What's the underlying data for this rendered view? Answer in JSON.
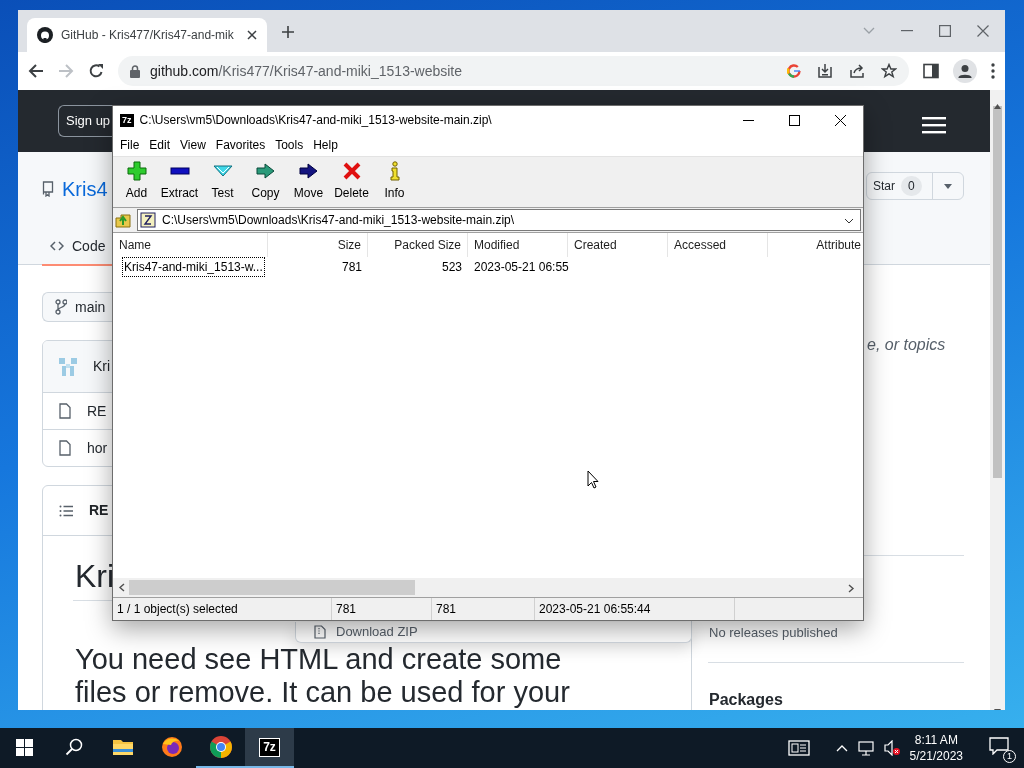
{
  "browser": {
    "tabs": [
      {
        "title": "GitHub - Kris477/Kris47-and-mik",
        "selected": true
      }
    ],
    "url_host": "github.com",
    "url_path": "/Kris477/Kris47-and-miki_1513-website"
  },
  "github": {
    "signup": "Sign up",
    "repo_title": "Kris4",
    "star_label": "Star",
    "star_count": "0",
    "tabs": [
      {
        "label": "Code",
        "selected": true
      }
    ],
    "branch": "main",
    "commit_author": "Kri",
    "files": [
      "RE",
      "hor"
    ],
    "readme_header": "RE",
    "readme_title": "Kri",
    "readme_text": [
      "You need see HTML and create some",
      "files or remove. It can be used for your"
    ],
    "about_fragment": "e, or topics",
    "releases_empty": "No releases published",
    "packages_heading": "Packages",
    "menu_items": [
      "Download ZIP"
    ]
  },
  "archive": {
    "icon_text": "7z",
    "title": "C:\\Users\\vm5\\Downloads\\Kris47-and-miki_1513-website-main.zip\\",
    "menu": [
      "File",
      "Edit",
      "View",
      "Favorites",
      "Tools",
      "Help"
    ],
    "toolbar": [
      {
        "label": "Add",
        "kind": "add"
      },
      {
        "label": "Extract",
        "kind": "extract"
      },
      {
        "label": "Test",
        "kind": "test"
      },
      {
        "label": "Copy",
        "kind": "copy"
      },
      {
        "label": "Move",
        "kind": "move"
      },
      {
        "label": "Delete",
        "kind": "delete"
      },
      {
        "label": "Info",
        "kind": "info"
      }
    ],
    "path": "C:\\Users\\vm5\\Downloads\\Kris47-and-miki_1513-website-main.zip\\",
    "columns": [
      "Name",
      "Size",
      "Packed Size",
      "Modified",
      "Created",
      "Accessed",
      "Attribute"
    ],
    "rows": [
      {
        "cells": [
          "Kris47-and-miki_1513-w...",
          "781",
          "523",
          "2023-05-21 06:55"
        ],
        "selected": true
      }
    ],
    "status": [
      "1 / 1 object(s) selected",
      "781",
      "781",
      "2023-05-21 06:55:44"
    ]
  },
  "taskbar": {
    "apps": [
      {
        "kind": "explorer",
        "running": false,
        "active": false
      },
      {
        "kind": "firefox",
        "running": false,
        "active": false
      },
      {
        "kind": "chrome",
        "running": true,
        "active": false
      },
      {
        "kind": "sevenzip",
        "label": "7z",
        "running": true,
        "active": true
      }
    ],
    "time": "8:11 AM",
    "date": "5/21/2023",
    "notifications": "1"
  }
}
